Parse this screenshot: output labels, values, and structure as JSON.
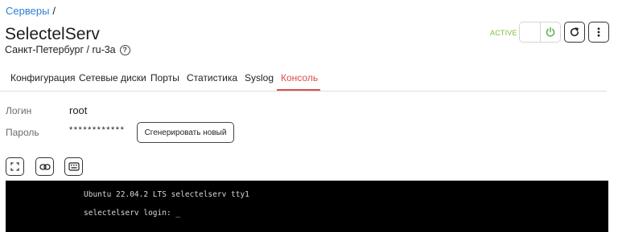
{
  "breadcrumb": {
    "servers_link": "Серверы",
    "separator": "/"
  },
  "server": {
    "name": "SelectelServ",
    "location": "Санкт-Петербург / ru-3a",
    "status": "ACTIVE"
  },
  "colors": {
    "link": "#2f7fd6",
    "status_active": "#7cbf3a",
    "tab_active": "#e04b4b",
    "console_bg": "#000000"
  },
  "tabs": [
    {
      "label": "Конфигурация",
      "active": false
    },
    {
      "label": "Сетевые диски",
      "active": false
    },
    {
      "label": "Порты",
      "active": false
    },
    {
      "label": "Статистика",
      "active": false
    },
    {
      "label": "Syslog",
      "active": false
    },
    {
      "label": "Консоль",
      "active": true
    }
  ],
  "credentials": {
    "login_label": "Логин",
    "login_value": "root",
    "password_label": "Пароль",
    "password_mask": "************",
    "generate_button": "Сгенерировать новый"
  },
  "toolbar_icons": [
    "fullscreen-icon",
    "link-icon",
    "keyboard-icon"
  ],
  "console": {
    "line1": "Ubuntu 22.04.2 LTS selectelserv tty1",
    "line2": "selectelserv login: _"
  }
}
